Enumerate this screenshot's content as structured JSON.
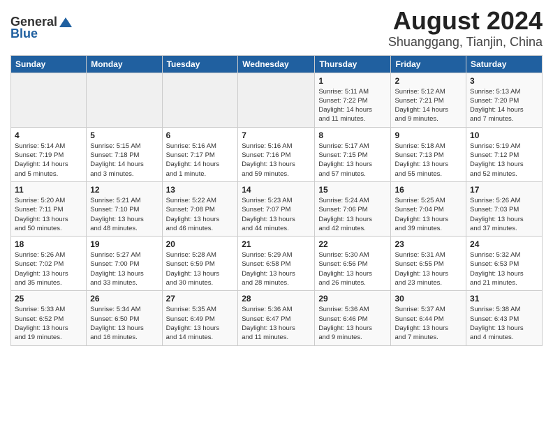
{
  "header": {
    "logo_general": "General",
    "logo_blue": "Blue",
    "month": "August 2024",
    "location": "Shuanggang, Tianjin, China"
  },
  "weekdays": [
    "Sunday",
    "Monday",
    "Tuesday",
    "Wednesday",
    "Thursday",
    "Friday",
    "Saturday"
  ],
  "weeks": [
    [
      {
        "day": "",
        "info": ""
      },
      {
        "day": "",
        "info": ""
      },
      {
        "day": "",
        "info": ""
      },
      {
        "day": "",
        "info": ""
      },
      {
        "day": "1",
        "info": "Sunrise: 5:11 AM\nSunset: 7:22 PM\nDaylight: 14 hours\nand 11 minutes."
      },
      {
        "day": "2",
        "info": "Sunrise: 5:12 AM\nSunset: 7:21 PM\nDaylight: 14 hours\nand 9 minutes."
      },
      {
        "day": "3",
        "info": "Sunrise: 5:13 AM\nSunset: 7:20 PM\nDaylight: 14 hours\nand 7 minutes."
      }
    ],
    [
      {
        "day": "4",
        "info": "Sunrise: 5:14 AM\nSunset: 7:19 PM\nDaylight: 14 hours\nand 5 minutes."
      },
      {
        "day": "5",
        "info": "Sunrise: 5:15 AM\nSunset: 7:18 PM\nDaylight: 14 hours\nand 3 minutes."
      },
      {
        "day": "6",
        "info": "Sunrise: 5:16 AM\nSunset: 7:17 PM\nDaylight: 14 hours\nand 1 minute."
      },
      {
        "day": "7",
        "info": "Sunrise: 5:16 AM\nSunset: 7:16 PM\nDaylight: 13 hours\nand 59 minutes."
      },
      {
        "day": "8",
        "info": "Sunrise: 5:17 AM\nSunset: 7:15 PM\nDaylight: 13 hours\nand 57 minutes."
      },
      {
        "day": "9",
        "info": "Sunrise: 5:18 AM\nSunset: 7:13 PM\nDaylight: 13 hours\nand 55 minutes."
      },
      {
        "day": "10",
        "info": "Sunrise: 5:19 AM\nSunset: 7:12 PM\nDaylight: 13 hours\nand 52 minutes."
      }
    ],
    [
      {
        "day": "11",
        "info": "Sunrise: 5:20 AM\nSunset: 7:11 PM\nDaylight: 13 hours\nand 50 minutes."
      },
      {
        "day": "12",
        "info": "Sunrise: 5:21 AM\nSunset: 7:10 PM\nDaylight: 13 hours\nand 48 minutes."
      },
      {
        "day": "13",
        "info": "Sunrise: 5:22 AM\nSunset: 7:08 PM\nDaylight: 13 hours\nand 46 minutes."
      },
      {
        "day": "14",
        "info": "Sunrise: 5:23 AM\nSunset: 7:07 PM\nDaylight: 13 hours\nand 44 minutes."
      },
      {
        "day": "15",
        "info": "Sunrise: 5:24 AM\nSunset: 7:06 PM\nDaylight: 13 hours\nand 42 minutes."
      },
      {
        "day": "16",
        "info": "Sunrise: 5:25 AM\nSunset: 7:04 PM\nDaylight: 13 hours\nand 39 minutes."
      },
      {
        "day": "17",
        "info": "Sunrise: 5:26 AM\nSunset: 7:03 PM\nDaylight: 13 hours\nand 37 minutes."
      }
    ],
    [
      {
        "day": "18",
        "info": "Sunrise: 5:26 AM\nSunset: 7:02 PM\nDaylight: 13 hours\nand 35 minutes."
      },
      {
        "day": "19",
        "info": "Sunrise: 5:27 AM\nSunset: 7:00 PM\nDaylight: 13 hours\nand 33 minutes."
      },
      {
        "day": "20",
        "info": "Sunrise: 5:28 AM\nSunset: 6:59 PM\nDaylight: 13 hours\nand 30 minutes."
      },
      {
        "day": "21",
        "info": "Sunrise: 5:29 AM\nSunset: 6:58 PM\nDaylight: 13 hours\nand 28 minutes."
      },
      {
        "day": "22",
        "info": "Sunrise: 5:30 AM\nSunset: 6:56 PM\nDaylight: 13 hours\nand 26 minutes."
      },
      {
        "day": "23",
        "info": "Sunrise: 5:31 AM\nSunset: 6:55 PM\nDaylight: 13 hours\nand 23 minutes."
      },
      {
        "day": "24",
        "info": "Sunrise: 5:32 AM\nSunset: 6:53 PM\nDaylight: 13 hours\nand 21 minutes."
      }
    ],
    [
      {
        "day": "25",
        "info": "Sunrise: 5:33 AM\nSunset: 6:52 PM\nDaylight: 13 hours\nand 19 minutes."
      },
      {
        "day": "26",
        "info": "Sunrise: 5:34 AM\nSunset: 6:50 PM\nDaylight: 13 hours\nand 16 minutes."
      },
      {
        "day": "27",
        "info": "Sunrise: 5:35 AM\nSunset: 6:49 PM\nDaylight: 13 hours\nand 14 minutes."
      },
      {
        "day": "28",
        "info": "Sunrise: 5:36 AM\nSunset: 6:47 PM\nDaylight: 13 hours\nand 11 minutes."
      },
      {
        "day": "29",
        "info": "Sunrise: 5:36 AM\nSunset: 6:46 PM\nDaylight: 13 hours\nand 9 minutes."
      },
      {
        "day": "30",
        "info": "Sunrise: 5:37 AM\nSunset: 6:44 PM\nDaylight: 13 hours\nand 7 minutes."
      },
      {
        "day": "31",
        "info": "Sunrise: 5:38 AM\nSunset: 6:43 PM\nDaylight: 13 hours\nand 4 minutes."
      }
    ]
  ]
}
